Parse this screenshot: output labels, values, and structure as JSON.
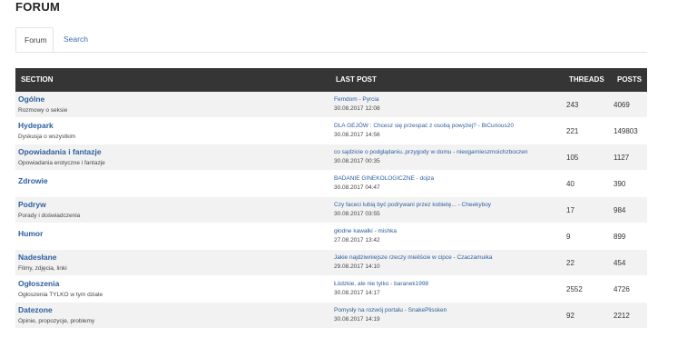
{
  "page": {
    "title": "FORUM"
  },
  "tabs": [
    {
      "label": "Forum"
    },
    {
      "label": "Search"
    }
  ],
  "table": {
    "headers": {
      "section": "SECTION",
      "last_post": "LAST POST",
      "threads": "THREADS",
      "posts": "POSTS"
    },
    "rows": [
      {
        "title": "Ogólne",
        "desc": "Rozmowy o seksie",
        "last_post": "Femdom - Pyrcia",
        "last_post_date": "30.08.2017 12:08",
        "threads": "243",
        "posts": "4069"
      },
      {
        "title": "Hydepark",
        "desc": "Dyskusja o wszystkim",
        "last_post": "DLA GEJÓW : Chcesz się przespać z osobą powyżej? - BiCurious20",
        "last_post_date": "30.08.2017 14:56",
        "threads": "221",
        "posts": "149803"
      },
      {
        "title": "Opowiadania i fantazje",
        "desc": "Opowiadania erotyczne i fantazje",
        "last_post": "co sądzicie o podglądaniu..przygody w domu - nieogarnieszmoichzboczen",
        "last_post_date": "30.08.2017 00:35",
        "threads": "105",
        "posts": "1127"
      },
      {
        "title": "Zdrowie",
        "desc": "",
        "last_post": "BADANIE GINEKOLOGICZNE - dojza",
        "last_post_date": "30.08.2017 04:47",
        "threads": "40",
        "posts": "390"
      },
      {
        "title": "Podryw",
        "desc": "Porady i doświadczenia",
        "last_post": "Czy faceci lubią być podrywani przez kobietę... - Cheekyboy",
        "last_post_date": "30.08.2017 03:55",
        "threads": "17",
        "posts": "984"
      },
      {
        "title": "Humor",
        "desc": "",
        "last_post": "głodne kawałki - mishka",
        "last_post_date": "27.08.2017 13:42",
        "threads": "9",
        "posts": "899"
      },
      {
        "title": "Nadesłane",
        "desc": "Filmy, zdjęcia, linki",
        "last_post": "Jakie najdziwniejsze rzeczy mieliście w cipce - Czaczamuika",
        "last_post_date": "29.08.2017 14:10",
        "threads": "22",
        "posts": "454"
      },
      {
        "title": "Ogłoszenia",
        "desc": "Ogłoszenia TYLKO w tym dziale",
        "last_post": "Łódzkie, ale nie tylko - baranek1998",
        "last_post_date": "30.08.2017 14:17",
        "threads": "2552",
        "posts": "4726"
      },
      {
        "title": "Datezone",
        "desc": "Opinie, propozycje, problemy",
        "last_post": "Pomysły na rozwój portalu - SnakePlissken",
        "last_post_date": "30.08.2017 14:19",
        "threads": "92",
        "posts": "2212"
      }
    ]
  }
}
